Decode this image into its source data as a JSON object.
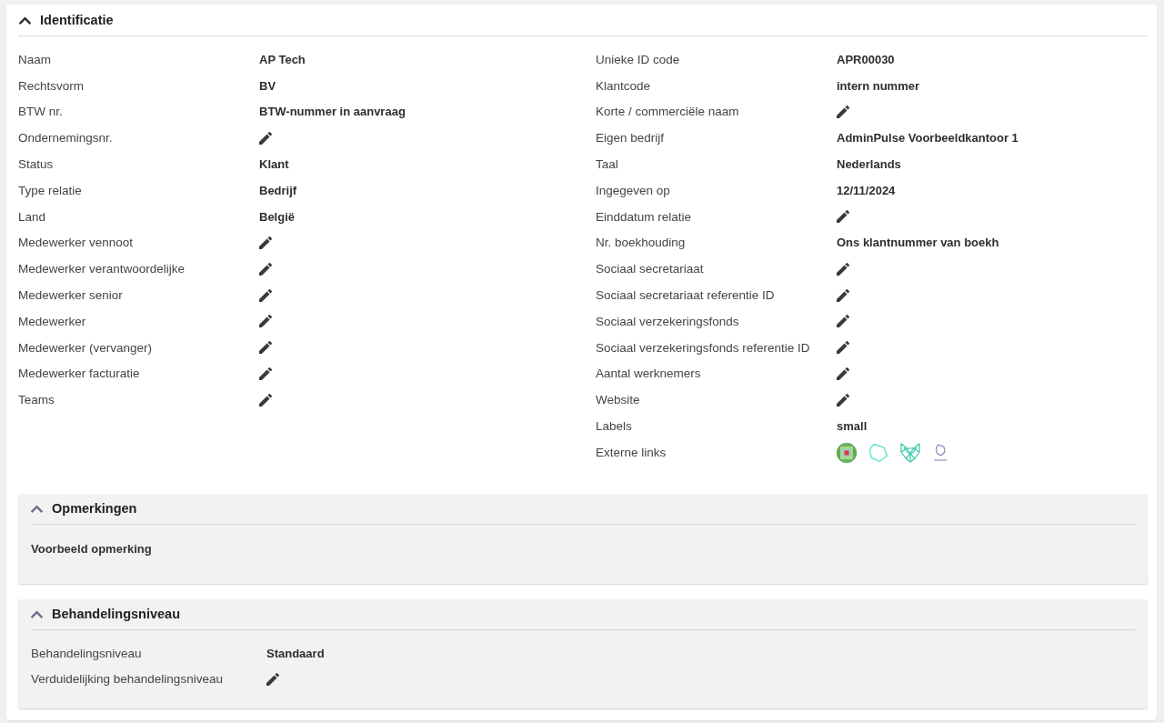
{
  "identification": {
    "title": "Identificatie",
    "expanded": true,
    "columns": [
      [
        {
          "label": "Naam",
          "kind": "text",
          "value": "AP Tech"
        },
        {
          "label": "Rechtsvorm",
          "kind": "text",
          "value": "BV"
        },
        {
          "label": "BTW nr.",
          "kind": "text",
          "value": "BTW-nummer in aanvraag"
        },
        {
          "label": "Ondernemingsnr.",
          "kind": "edit"
        },
        {
          "label": "Status",
          "kind": "text",
          "value": "Klant"
        },
        {
          "label": "Type relatie",
          "kind": "text",
          "value": "Bedrijf"
        },
        {
          "label": "Land",
          "kind": "text",
          "value": "België"
        },
        {
          "label": "Medewerker vennoot",
          "kind": "edit"
        },
        {
          "label": "Medewerker verantwoordelijke",
          "kind": "edit"
        },
        {
          "label": "Medewerker senior",
          "kind": "edit"
        },
        {
          "label": "Medewerker",
          "kind": "edit"
        },
        {
          "label": "Medewerker (vervanger)",
          "kind": "edit"
        },
        {
          "label": "Medewerker facturatie",
          "kind": "edit"
        },
        {
          "label": "Teams",
          "kind": "edit"
        }
      ],
      [
        {
          "label": "Unieke ID code",
          "kind": "text",
          "value": "APR00030"
        },
        {
          "label": "Klantcode",
          "kind": "text",
          "value": "intern nummer"
        },
        {
          "label": "Korte / commerciële naam",
          "kind": "edit"
        },
        {
          "label": "Eigen bedrijf",
          "kind": "text",
          "value": "AdminPulse Voorbeeldkantoor 1"
        },
        {
          "label": "Taal",
          "kind": "text",
          "value": "Nederlands"
        },
        {
          "label": "Ingegeven op",
          "kind": "text",
          "value": "12/11/2024"
        },
        {
          "label": "Einddatum relatie",
          "kind": "edit"
        },
        {
          "label": "Nr. boekhouding",
          "kind": "text",
          "value": "Ons klantnummer van boekh"
        },
        {
          "label": "Sociaal secretariaat",
          "kind": "edit"
        },
        {
          "label": "Sociaal secretariaat referentie ID",
          "kind": "edit"
        },
        {
          "label": "Sociaal verzekeringsfonds",
          "kind": "edit"
        },
        {
          "label": "Sociaal verzekeringsfonds referentie ID",
          "kind": "edit"
        },
        {
          "label": "Aantal werknemers",
          "kind": "edit"
        },
        {
          "label": "Website",
          "kind": "edit"
        },
        {
          "label": "Labels",
          "kind": "text",
          "value": "small"
        },
        {
          "label": "Externe links",
          "kind": "links"
        }
      ]
    ]
  },
  "panels": [
    {
      "kind": "note",
      "title": "Opmerkingen",
      "expanded": true,
      "note": "Voorbeeld opmerking"
    },
    {
      "kind": "fields",
      "title": "Behandelingsniveau",
      "expanded": true,
      "fields": [
        {
          "label": "Behandelingsniveau",
          "kind": "text",
          "value": "Standaard"
        },
        {
          "label": "Verduidelijking behandelingsniveau",
          "kind": "edit"
        }
      ]
    }
  ]
}
